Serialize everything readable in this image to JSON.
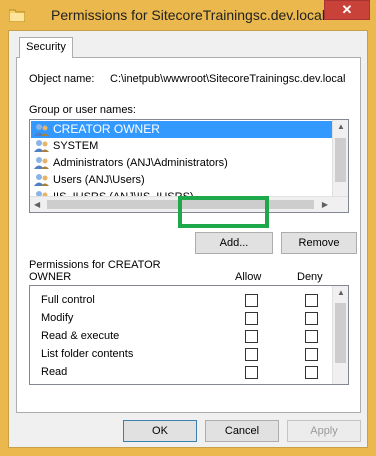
{
  "window": {
    "title": "Permissions for SitecoreTrainingsc.dev.local",
    "close_glyph": "✕"
  },
  "tabs": [
    {
      "label": "Security"
    }
  ],
  "object": {
    "label": "Object name:",
    "value": "C:\\inetpub\\wwwroot\\SitecoreTrainingsc.dev.local"
  },
  "groups": {
    "label": "Group or user names:",
    "items": [
      {
        "label": "CREATOR OWNER",
        "selected": true
      },
      {
        "label": "SYSTEM",
        "selected": false
      },
      {
        "label": "Administrators (ANJ\\Administrators)",
        "selected": false
      },
      {
        "label": "Users (ANJ\\Users)",
        "selected": false
      },
      {
        "label": "IIS_IUSRS (ANJ\\IIS_IUSRS)",
        "selected": false
      }
    ]
  },
  "buttons": {
    "add": "Add...",
    "remove": "Remove",
    "ok": "OK",
    "cancel": "Cancel",
    "apply": "Apply"
  },
  "permissions": {
    "header_line1": "Permissions for CREATOR",
    "header_line2": "OWNER",
    "allow_label": "Allow",
    "deny_label": "Deny",
    "rows": [
      {
        "name": "Full control",
        "allow": false,
        "deny": false
      },
      {
        "name": "Modify",
        "allow": false,
        "deny": false
      },
      {
        "name": "Read & execute",
        "allow": false,
        "deny": false
      },
      {
        "name": "List folder contents",
        "allow": false,
        "deny": false
      },
      {
        "name": "Read",
        "allow": false,
        "deny": false
      }
    ]
  },
  "colors": {
    "selection": "#3399ff",
    "highlight": "#1fa84a",
    "frame": "#eab84d"
  }
}
